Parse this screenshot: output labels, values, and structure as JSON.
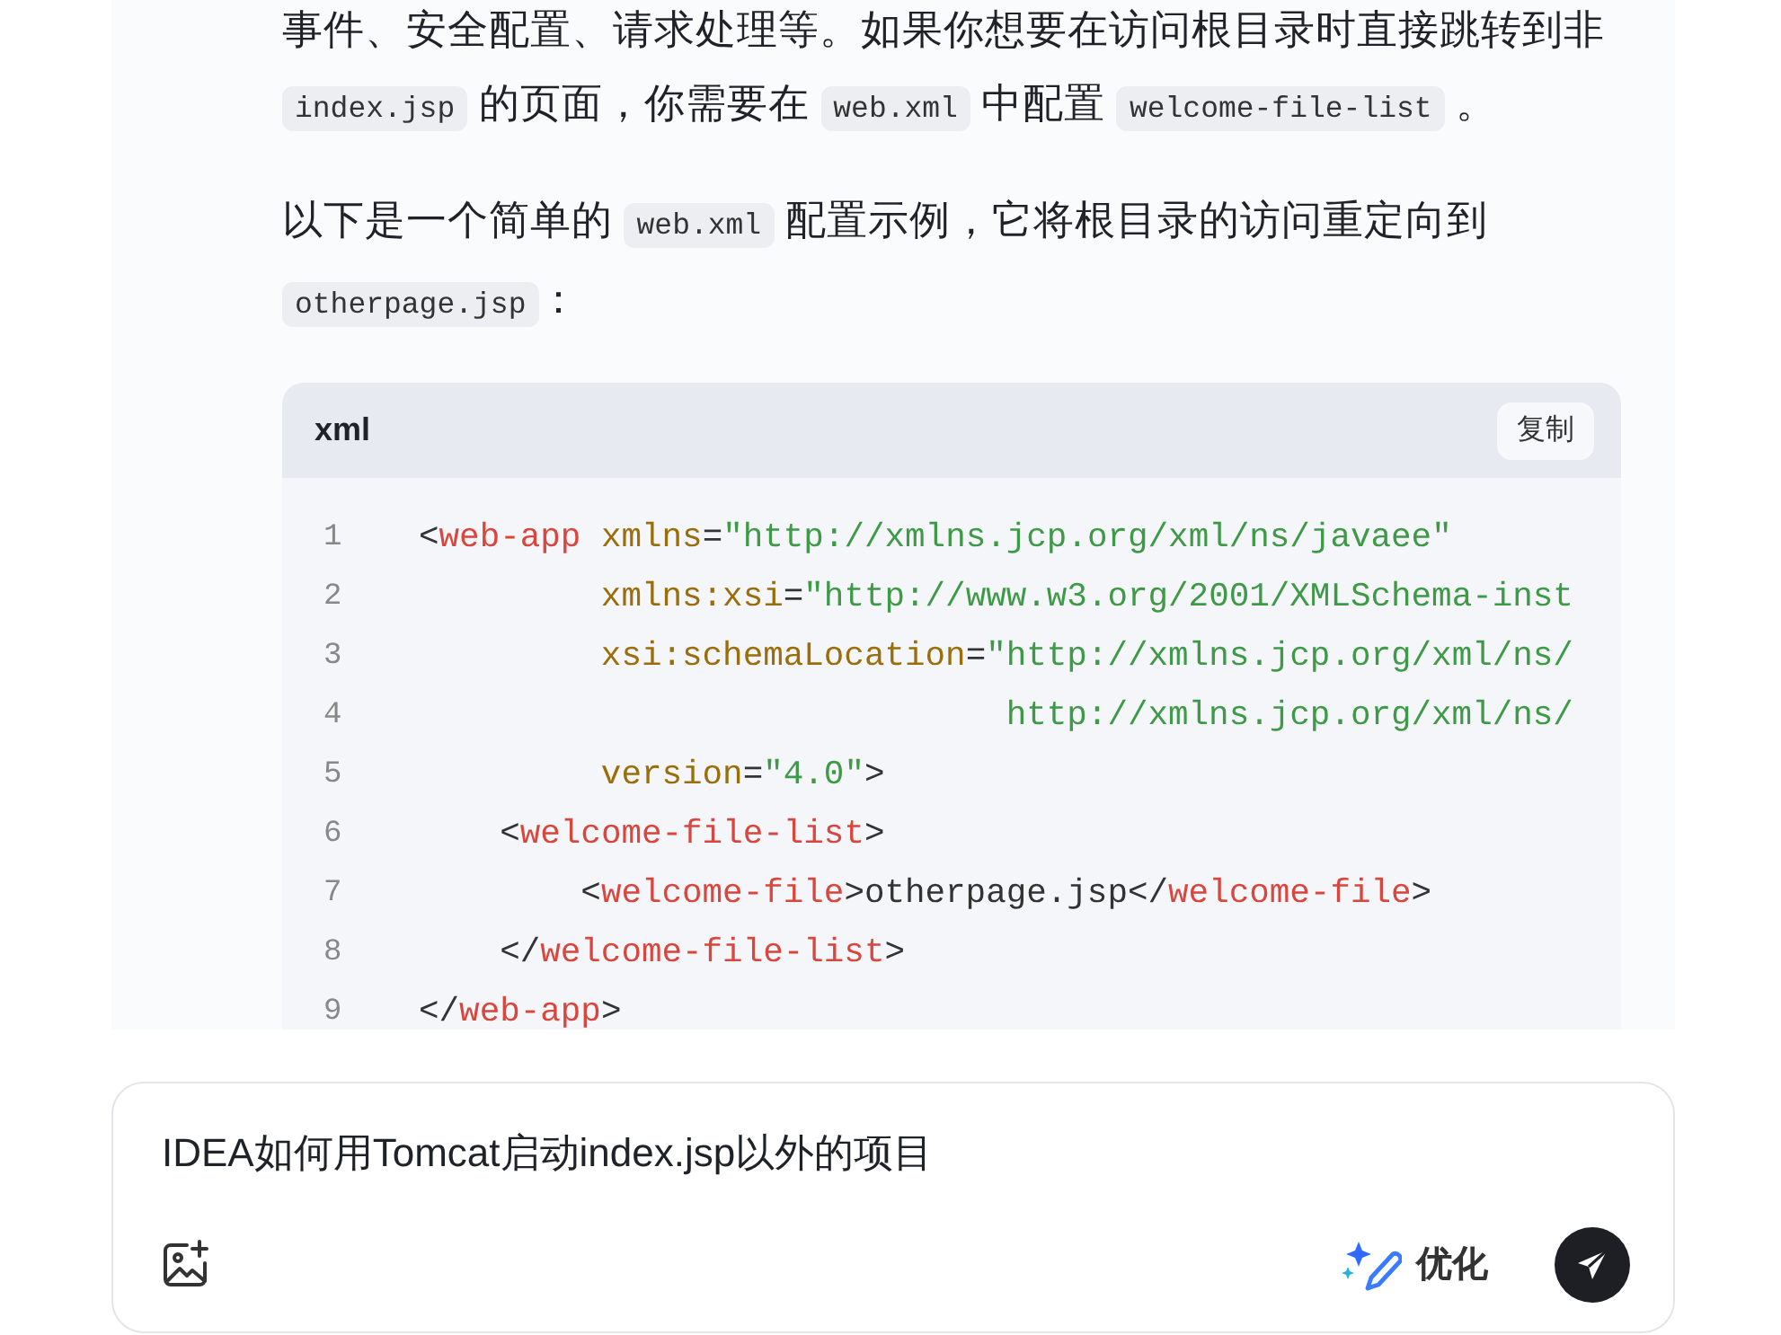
{
  "message": {
    "paragraphs": [
      [
        {
          "kind": "text",
          "text": "事件、安全配置、请求处理等。如果你想要在访问根目录时直接跳转到非"
        },
        {
          "kind": "code",
          "text": "index.jsp"
        },
        {
          "kind": "text",
          "text": " 的页面，你需要在 "
        },
        {
          "kind": "code",
          "text": "web.xml"
        },
        {
          "kind": "text",
          "text": " 中配置 "
        },
        {
          "kind": "code",
          "text": "welcome-file-list"
        },
        {
          "kind": "text",
          "text": " 。"
        }
      ],
      [
        {
          "kind": "text",
          "text": "以下是一个简单的 "
        },
        {
          "kind": "code",
          "text": "web.xml"
        },
        {
          "kind": "text",
          "text": " 配置示例，它将根目录的访问重定向到"
        },
        {
          "kind": "code",
          "text": "otherpage.jsp"
        },
        {
          "kind": "text",
          "text": "："
        }
      ]
    ],
    "code_block": {
      "language": "xml",
      "copy_button": "复制",
      "lines": [
        {
          "number": "1",
          "tokens": [
            {
              "kind": "punct",
              "text": "<"
            },
            {
              "kind": "tag",
              "text": "web-app"
            },
            {
              "kind": "attr",
              "text": " xmlns"
            },
            {
              "kind": "punct",
              "text": "="
            },
            {
              "kind": "string",
              "text": "\"http://xmlns.jcp.org/xml/ns/javaee\""
            }
          ]
        },
        {
          "number": "2",
          "tokens": [
            {
              "kind": "attr",
              "text": "         xmlns:xsi"
            },
            {
              "kind": "punct",
              "text": "="
            },
            {
              "kind": "string",
              "text": "\"http://www.w3.org/2001/XMLSchema-inst"
            }
          ]
        },
        {
          "number": "3",
          "tokens": [
            {
              "kind": "attr",
              "text": "         xsi:schemaLocation"
            },
            {
              "kind": "punct",
              "text": "="
            },
            {
              "kind": "string",
              "text": "\"http://xmlns.jcp.org/xml/ns/"
            }
          ]
        },
        {
          "number": "4",
          "tokens": [
            {
              "kind": "string",
              "text": "                             http://xmlns.jcp.org/xml/ns/"
            }
          ]
        },
        {
          "number": "5",
          "tokens": [
            {
              "kind": "attr",
              "text": "         version"
            },
            {
              "kind": "punct",
              "text": "="
            },
            {
              "kind": "string",
              "text": "\"4.0\""
            },
            {
              "kind": "punct",
              "text": ">"
            }
          ]
        },
        {
          "number": "6",
          "tokens": [
            {
              "kind": "punct",
              "text": "    <"
            },
            {
              "kind": "tag",
              "text": "welcome-file-list"
            },
            {
              "kind": "punct",
              "text": ">"
            }
          ]
        },
        {
          "number": "7",
          "tokens": [
            {
              "kind": "punct",
              "text": "        <"
            },
            {
              "kind": "tag",
              "text": "welcome-file"
            },
            {
              "kind": "punct",
              "text": ">otherpage.jsp</"
            },
            {
              "kind": "tag",
              "text": "welcome-file"
            },
            {
              "kind": "punct",
              "text": ">"
            }
          ]
        },
        {
          "number": "8",
          "tokens": [
            {
              "kind": "punct",
              "text": "    </"
            },
            {
              "kind": "tag",
              "text": "welcome-file-list"
            },
            {
              "kind": "punct",
              "text": ">"
            }
          ]
        },
        {
          "number": "9",
          "tokens": [
            {
              "kind": "punct",
              "text": "</"
            },
            {
              "kind": "tag",
              "text": "web-app"
            },
            {
              "kind": "punct",
              "text": ">"
            }
          ]
        }
      ]
    }
  },
  "composer": {
    "value": "IDEA如何用Tomcat启动index.jsp以外的项目",
    "optimize_button": "优化"
  }
}
